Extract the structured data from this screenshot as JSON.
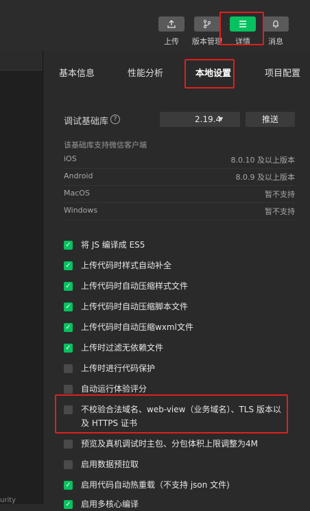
{
  "toolbar": {
    "upload_label": "上传",
    "version_label": "版本管理",
    "details_label": "详情",
    "messages_label": "消息"
  },
  "left_panel": {
    "bottom_text": "urity"
  },
  "tabs": [
    {
      "label": "基本信息"
    },
    {
      "label": "性能分析"
    },
    {
      "label": "本地设置"
    },
    {
      "label": "项目配置"
    }
  ],
  "base_lib": {
    "label": "调试基础库",
    "help": "?",
    "version": "2.19.4",
    "push_label": "推送",
    "support_title": "该基础库支持微信客户端",
    "rows": [
      {
        "os": "iOS",
        "version": "8.0.10 及以上版本"
      },
      {
        "os": "Android",
        "version": "8.0.9 及以上版本"
      },
      {
        "os": "MacOS",
        "version": "暂不支持"
      },
      {
        "os": "Windows",
        "version": "暂不支持"
      }
    ]
  },
  "settings": [
    {
      "label": "将 JS 编译成 ES5",
      "checked": true
    },
    {
      "label": "上传代码时样式自动补全",
      "checked": true
    },
    {
      "label": "上传代码时自动压缩样式文件",
      "checked": true
    },
    {
      "label": "上传代码时自动压缩脚本文件",
      "checked": true
    },
    {
      "label": "上传代码时自动压缩wxml文件",
      "checked": true
    },
    {
      "label": "上传时过滤无依赖文件",
      "checked": true
    },
    {
      "label": "上传时进行代码保护",
      "checked": false
    },
    {
      "label": "自动运行体验评分",
      "checked": false
    },
    {
      "label": "不校验合法域名、web-view（业务域名）、TLS 版本以及 HTTPS 证书",
      "checked": false
    },
    {
      "label": "预览及真机调试时主包、分包体积上限调整为4M",
      "checked": false
    },
    {
      "label": "启用数据预拉取",
      "checked": false
    },
    {
      "label": "启用代码自动热重载（不支持 json 文件)",
      "checked": true
    },
    {
      "label": "启用多核心编译",
      "checked": true
    }
  ],
  "colors": {
    "accent": "#07c160",
    "highlight": "#e02020",
    "panel_bg": "#2a2a2a"
  }
}
